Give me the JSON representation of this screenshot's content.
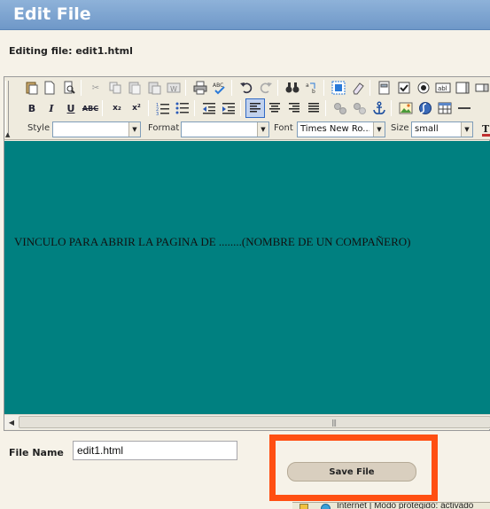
{
  "window": {
    "title": "Edit File"
  },
  "editing": {
    "label": "Editing file: edit1.html"
  },
  "toolbar": {
    "row1": [
      {
        "name": "paste-icon",
        "glyph": "📋"
      },
      {
        "name": "new-page-icon",
        "glyph": "🗋"
      },
      {
        "name": "preview-icon",
        "glyph": "🔍"
      },
      {
        "name": "cut-icon",
        "glyph": "✂"
      },
      {
        "name": "copy-icon",
        "glyph": "⎘"
      },
      {
        "name": "paste-text-icon",
        "glyph": "📋"
      },
      {
        "name": "paste-word-icon",
        "glyph": "W"
      },
      {
        "name": "print-icon",
        "glyph": "🖶"
      },
      {
        "name": "spellcheck-icon",
        "glyph": "ABC✓"
      },
      {
        "name": "undo-icon",
        "glyph": "↶"
      },
      {
        "name": "redo-icon",
        "glyph": "↷"
      },
      {
        "name": "find-icon",
        "glyph": "🔭"
      },
      {
        "name": "replace-icon",
        "glyph": "ab"
      },
      {
        "name": "select-all-icon",
        "glyph": "▦"
      },
      {
        "name": "remove-format-icon",
        "glyph": "⌫"
      },
      {
        "name": "form-icon",
        "glyph": "▣"
      },
      {
        "name": "checkbox-icon",
        "glyph": "☑"
      },
      {
        "name": "radio-icon",
        "glyph": "◉"
      },
      {
        "name": "textfield-icon",
        "glyph": "abl"
      }
    ],
    "row2": [
      {
        "name": "bold-icon",
        "glyph": "B"
      },
      {
        "name": "italic-icon",
        "glyph": "I"
      },
      {
        "name": "underline-icon",
        "glyph": "U"
      },
      {
        "name": "strikethrough-icon",
        "glyph": "ABC"
      },
      {
        "name": "subscript-icon",
        "glyph": "x₂"
      },
      {
        "name": "superscript-icon",
        "glyph": "x²"
      },
      {
        "name": "numbered-list-icon",
        "glyph": "1≡"
      },
      {
        "name": "bulleted-list-icon",
        "glyph": "•≡"
      },
      {
        "name": "outdent-icon",
        "glyph": "⇤"
      },
      {
        "name": "indent-icon",
        "glyph": "⇥"
      },
      {
        "name": "align-left-icon",
        "glyph": "≡"
      },
      {
        "name": "align-center-icon",
        "glyph": "≡"
      },
      {
        "name": "align-right-icon",
        "glyph": "≡"
      },
      {
        "name": "justify-icon",
        "glyph": "≡"
      },
      {
        "name": "link-icon",
        "glyph": "🔗"
      },
      {
        "name": "unlink-icon",
        "glyph": "⛓"
      },
      {
        "name": "anchor-icon",
        "glyph": "⚓"
      },
      {
        "name": "image-icon",
        "glyph": "🖼"
      },
      {
        "name": "flash-icon",
        "glyph": "ƒ"
      },
      {
        "name": "table-icon",
        "glyph": "▤"
      }
    ],
    "style_label": "Style",
    "style_value": "",
    "format_label": "Format",
    "format_value": "",
    "font_label": "Font",
    "font_value": "Times New Ro...",
    "size_label": "Size",
    "size_value": "small"
  },
  "content": {
    "text": "VINCULO PARA ABRIR LA PAGINA DE ........(NOMBRE DE UN COMPAÑERO)",
    "background": "#008080"
  },
  "form": {
    "filename_label": "File Name",
    "filename_value": "edit1.html",
    "save_label": "Save File"
  },
  "status": {
    "text": "Internet | Modo protegido: activado"
  },
  "colors": {
    "highlight": "#ff4f12",
    "title_bar": "#7aa3d2",
    "page_bg": "#f6f2e8"
  }
}
